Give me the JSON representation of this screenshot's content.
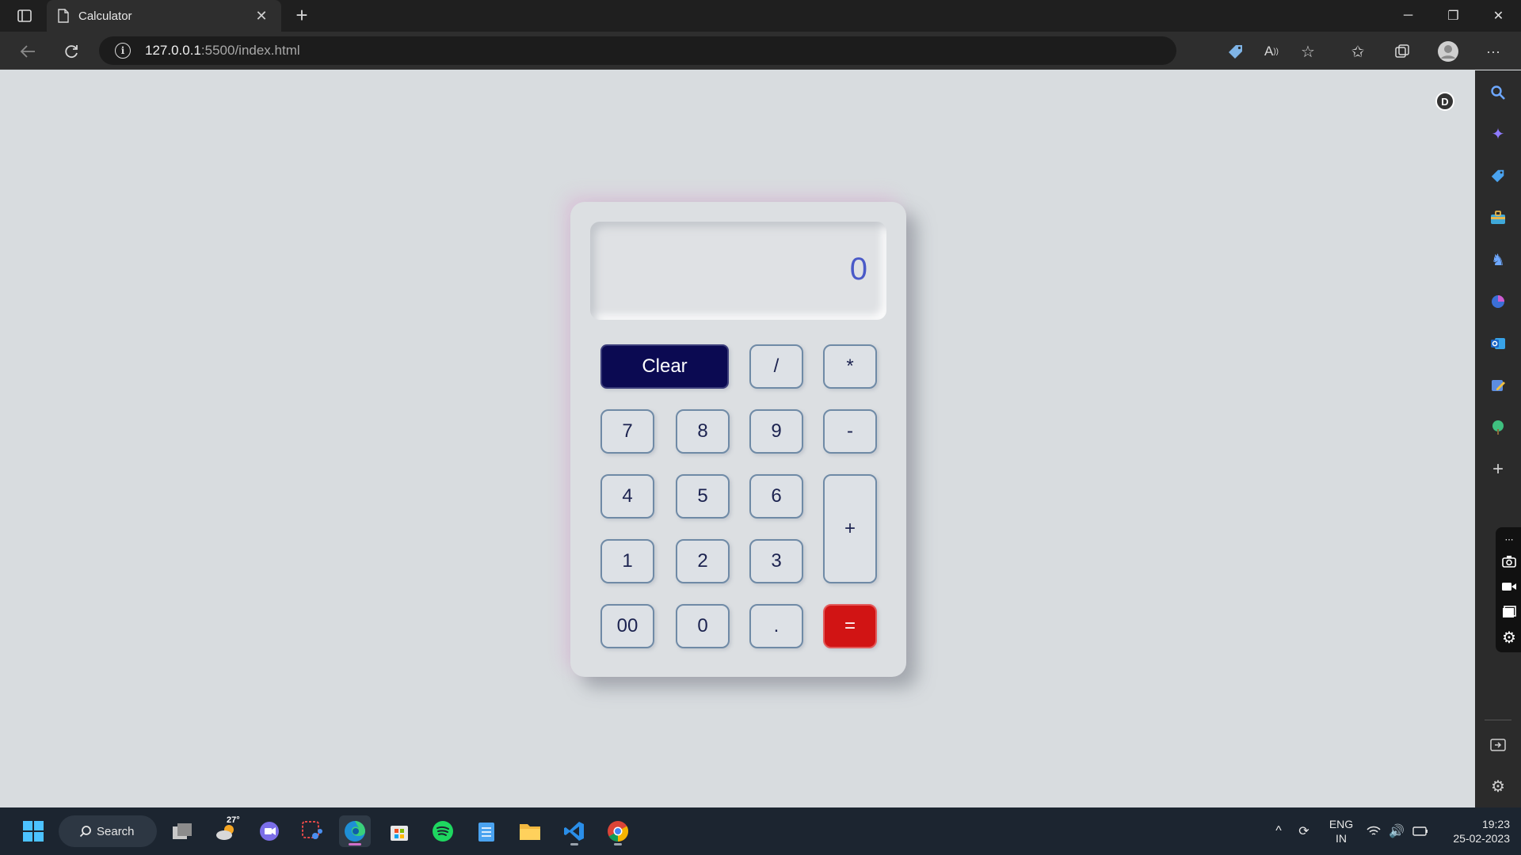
{
  "browser": {
    "tab_title": "Calculator",
    "tab_close": "✕",
    "new_tab": "+",
    "url_host": "127.0.0.1",
    "url_path": ":5500/index.html",
    "window": {
      "minimize": "─",
      "restore": "❐",
      "close": "✕"
    }
  },
  "page": {
    "theme_toggle_label": "D"
  },
  "calculator": {
    "display_value": "0",
    "keys": {
      "clear": "Clear",
      "divide": "/",
      "multiply": "*",
      "seven": "7",
      "eight": "8",
      "nine": "9",
      "minus": "-",
      "four": "4",
      "five": "5",
      "six": "6",
      "plus": "+",
      "one": "1",
      "two": "2",
      "three": "3",
      "double_zero": "00",
      "zero": "0",
      "decimal": ".",
      "equals": "="
    }
  },
  "taskbar": {
    "search_label": "Search",
    "weather": "27°",
    "language_top": "ENG",
    "language_bottom": "IN",
    "time": "19:23",
    "date": "25-02-2023"
  },
  "colors": {
    "page_bg": "#d8dcdf",
    "display_text": "#4a5ac8",
    "clear_button": "#0b0a52",
    "equals_button": "#d11414",
    "key_border": "#6f8aa6"
  }
}
